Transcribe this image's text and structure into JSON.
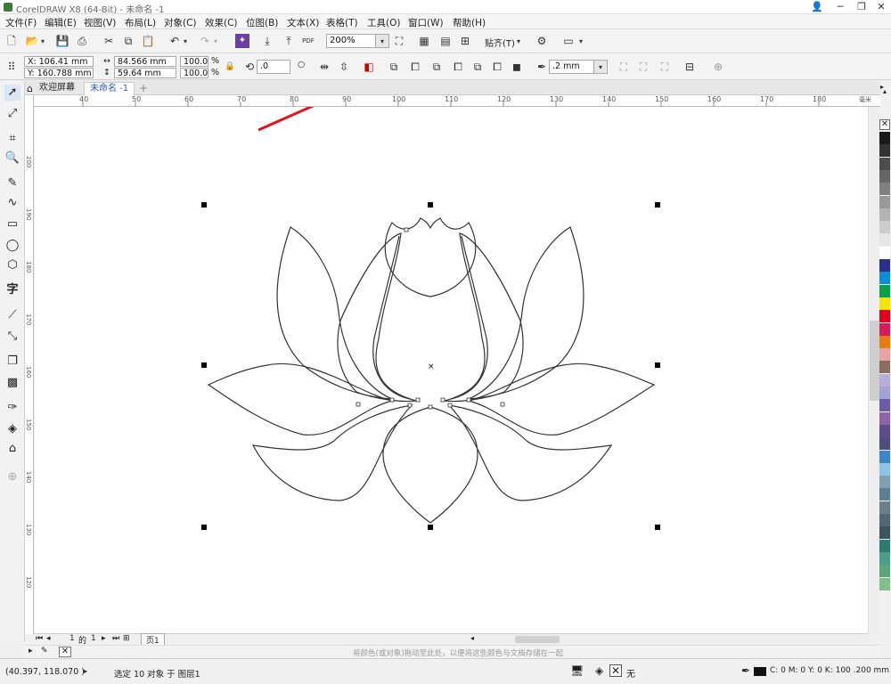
{
  "title": "CorelDRAW X8 (64-Bit) - 未命名 -1",
  "menu": [
    "文件(F)",
    "编辑(E)",
    "视图(V)",
    "布局(L)",
    "对象(C)",
    "效果(C)",
    "位图(B)",
    "文本(X)",
    "表格(T)",
    "工具(O)",
    "窗口(W)",
    "帮助(H)"
  ],
  "toolbar": {
    "zoom": "200%",
    "snap": "贴齐(T)"
  },
  "props": {
    "x": "X: 106.41 mm",
    "y": "Y: 160.788 mm",
    "w": "84.566 mm",
    "h": "59.64 mm",
    "sx": "100.0",
    "sy": "100.0",
    "pct": "%",
    "pct2": "%",
    "angle": ".0",
    "outline": ".2 mm"
  },
  "tabs": {
    "welcome": "欢迎屏幕",
    "doc": "未命名 -1"
  },
  "ruler_h": [
    "40",
    "50",
    "60",
    "70",
    "80",
    "90",
    "100",
    "110",
    "120",
    "130",
    "140",
    "150",
    "160",
    "170",
    "180"
  ],
  "ruler_h_unit": "毫米",
  "ruler_v": [
    "200",
    "190",
    "180",
    "170",
    "160",
    "150",
    "140",
    "130",
    "120"
  ],
  "pages": {
    "current": "1",
    "of": "的",
    "total": "1",
    "tab": "页1"
  },
  "docpal_hint": "将颜色(或对象)拖动至此处，以便将这些颜色与文档存储在一起",
  "status": {
    "coords": "(40.397, 118.070 )",
    "selection": "选定 10 对象 于 图层1",
    "fill": "无",
    "outline": "C: 0 M: 0 Y: 0 K: 100  .200 mm"
  },
  "palette": [
    "#1a1a1a",
    "#333333",
    "#4d4d4d",
    "#666666",
    "#808080",
    "#999999",
    "#b3b3b3",
    "#cccccc",
    "#e6e6e6",
    "#ffffff",
    "#2b2f8f",
    "#0a8fd6",
    "#0aa04b",
    "#f5e400",
    "#e3001b",
    "#d81b60",
    "#e87d0d",
    "#e8a3a3",
    "#8c6d62",
    "#b8aed6",
    "#9fa3d6",
    "#6c5ca8",
    "#8e63a8",
    "#5a4f8a",
    "#4e4e7e",
    "#3a86c8",
    "#8fc3e6",
    "#7f9fb2",
    "#5c8093",
    "#697f8a",
    "#4f6a73",
    "#3a5460",
    "#2f7a70",
    "#4c9d8a",
    "#5aa57a",
    "#7fbf8a"
  ],
  "colors": {
    "accent": "#3a7ad6",
    "annotation": "#e0141e"
  }
}
